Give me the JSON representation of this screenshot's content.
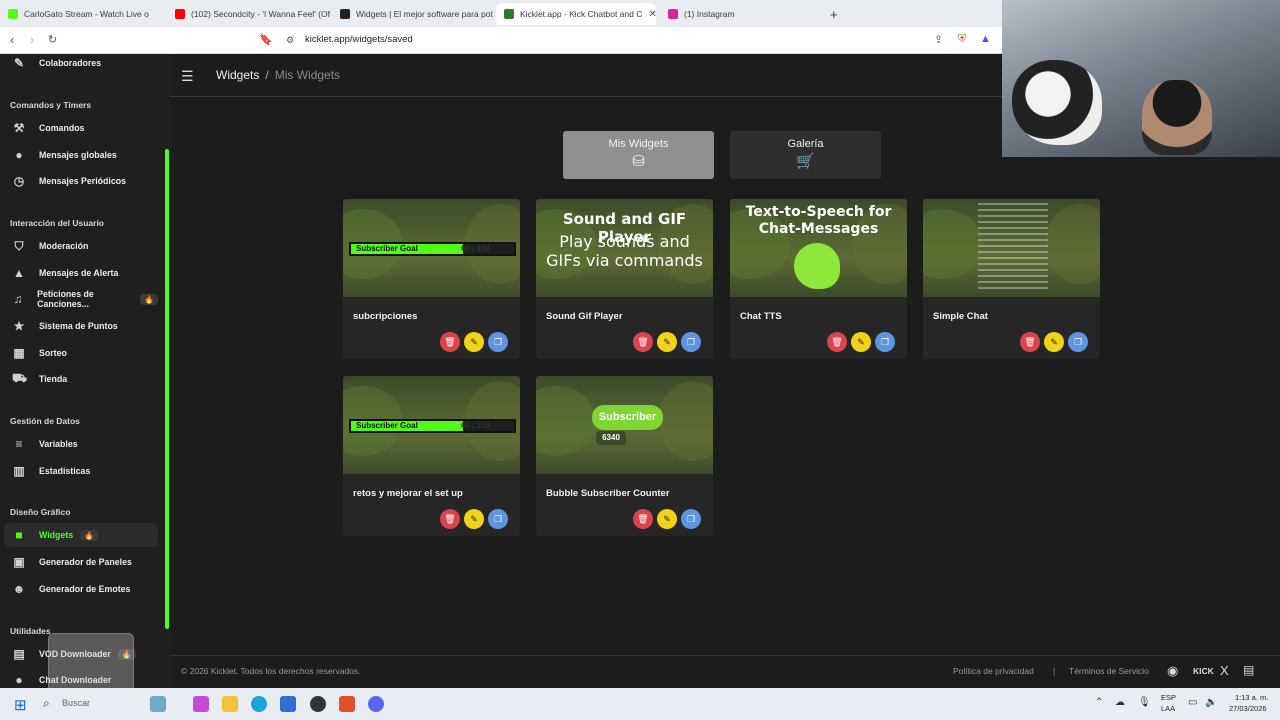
{
  "browser": {
    "tabs": [
      {
        "label": "CarloGato Stream - Watch Live o",
        "color": "#53fc18"
      },
      {
        "label": "(102) Secondcity - 'I Wanna Feel' (Of",
        "color": "#ff0000"
      },
      {
        "label": "Widgets | El mejor software para pot",
        "color": "#222222"
      },
      {
        "label": "Kicklet.app - Kick Chatbot and C",
        "color": "#2d7a2d"
      },
      {
        "label": "(1) Instagram",
        "color": "#d6249f"
      }
    ],
    "url": "kicklet.app/widgets/saved"
  },
  "sidebar": {
    "top_item": "Colaboradores",
    "sections": [
      {
        "title": "Comandos y Timers",
        "items": [
          "Comandos",
          "Mensajes globales",
          "Mensajes Periódicos"
        ]
      },
      {
        "title": "Interacción del Usuario",
        "items": [
          "Moderación",
          "Mensajes de Alerta",
          "Peticiones de Canciones...",
          "Sistema de Puntos",
          "Sorteo",
          "Tienda"
        ]
      },
      {
        "title": "Gestión de Datos",
        "items": [
          "Variables",
          "Estadísticas"
        ]
      },
      {
        "title": "Diseño Gráfico",
        "items": [
          "Widgets",
          "Generador de Paneles",
          "Generador de Emotes"
        ]
      },
      {
        "title": "Utilidades",
        "items": [
          "VOD Downloader",
          "Chat Downloader"
        ]
      }
    ],
    "badges": {
      "widgets": "🔥",
      "peticiones": "🔥",
      "vod": "🔥"
    }
  },
  "header": {
    "title": "Widgets",
    "separator": "/",
    "subtitle": "Mis Widgets"
  },
  "tabs": {
    "mine": "Mis Widgets",
    "gallery": "Galería"
  },
  "cards": [
    {
      "title": "subcripciones",
      "goal_label": "Subscriber Goal",
      "goal_count": "69 / 100",
      "goal_progress": 0.69
    },
    {
      "title": "Sound Gif Player",
      "thumb_head": "Sound and GIF Player",
      "thumb_sub": "Play sounds and GIFs via commands"
    },
    {
      "title": "Chat TTS",
      "thumb_head": "Text-to-Speech for Chat-Messages"
    },
    {
      "title": "Simple Chat"
    },
    {
      "title": "retos y mejorar el set up",
      "goal_label": "Subscriber Goal",
      "goal_count": "69 / 100",
      "goal_progress": 0.69
    },
    {
      "title": "Bubble Subscriber Counter",
      "bubble_label": "Subscriber",
      "bubble_count": "6340"
    }
  ],
  "footer": {
    "copyright": "© 2026 Kicklet. Todos los derechos reservados.",
    "privacy": "Política de privacidad",
    "divider": "|",
    "terms": "Términos de Servicio",
    "kick": "KICK",
    "x": "X"
  },
  "taskbar": {
    "search_placeholder": "Buscar",
    "lang": "ESP",
    "layout": "LAA",
    "time": "1:13 a. m.",
    "date": "27/03/2026"
  }
}
